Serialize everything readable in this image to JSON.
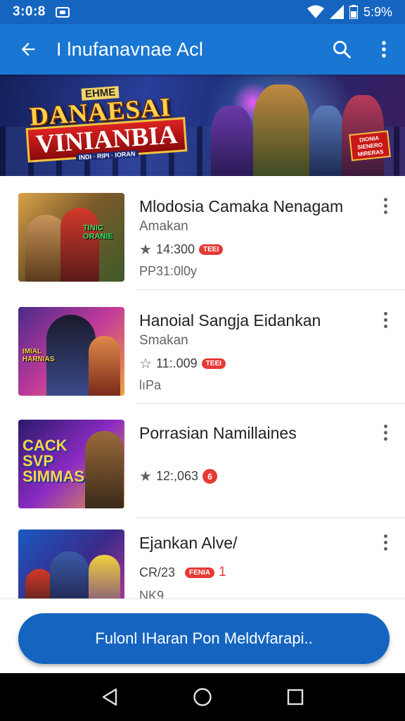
{
  "status_bar": {
    "time": "3:0:8",
    "battery": "5:9%",
    "icons": [
      "notification-icon",
      "wifi-icon",
      "signal-icon",
      "battery-icon"
    ]
  },
  "app_bar": {
    "title": "I lnufanavnae Acl",
    "icons": [
      "back-arrow-icon",
      "search-icon",
      "more-vert-icon"
    ]
  },
  "banner": {
    "small_top": "EHME",
    "logo_line1": "DANAESAI",
    "logo_line2": "VINIANBIA",
    "tagline": "INDI · RIPI · IORAN",
    "badge": "DIONIA SIENERO MIRERAS"
  },
  "items": [
    {
      "name": "Mlodosia Camaka Nenagam",
      "developer": "Amakan",
      "rating": "14:300",
      "rating_star": "filled",
      "pill": "TEEI",
      "size": "PP31:0l0y",
      "thumb_caption": "TINIC ORANIE"
    },
    {
      "name": "Hanoial Sangja Eidankan",
      "developer": "Smakan",
      "rating": "11:.009",
      "rating_star": "outline",
      "pill": "TEEI",
      "size": "lıPa",
      "thumb_caption": "IMIAL HARNIAS"
    },
    {
      "name": "Porrasian Namillaines",
      "developer": "",
      "rating": "12:,063",
      "rating_star": "filled",
      "pill": "6",
      "size": "",
      "thumb_caption": "CACK SVP SIMMAS"
    },
    {
      "name": "Ejankan Alve/",
      "developer": "",
      "rating": "CR/23",
      "rating_star": "none",
      "pill": "FENIA",
      "red_num": "1",
      "size": "NK9",
      "thumb_caption": ""
    }
  ],
  "cta": {
    "label": "Fulonl IHaran Pon Meldvfarapi.."
  },
  "nav": {
    "icons": [
      "nav-back-icon",
      "nav-home-icon",
      "nav-recents-icon"
    ]
  },
  "colors": {
    "status_bar": "#1565c0",
    "app_bar": "#1976d2",
    "accent_red": "#e53935",
    "cta": "#1565c0"
  }
}
